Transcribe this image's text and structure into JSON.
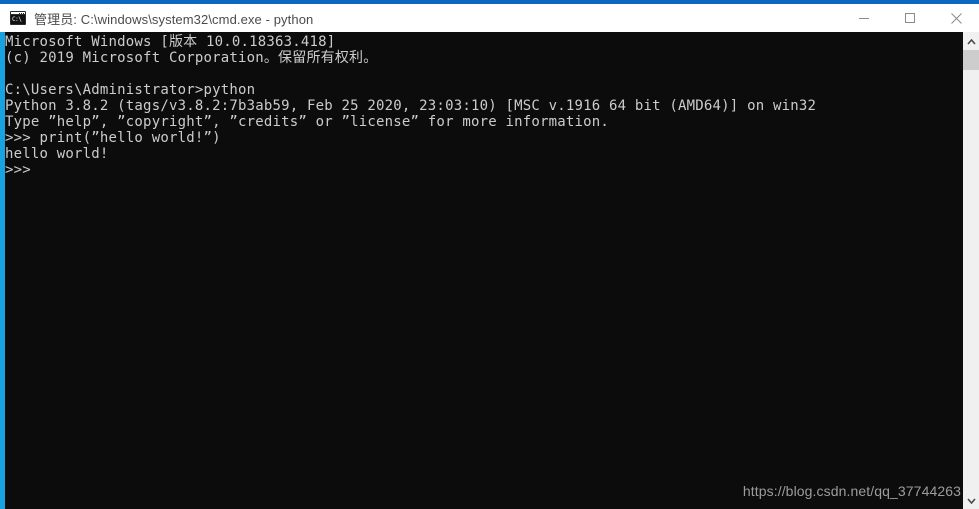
{
  "window": {
    "title": "管理员: C:\\windows\\system32\\cmd.exe - python",
    "icon_name": "cmd-console-icon",
    "icon_text": "C:\\",
    "accent_color": "#0c68c0",
    "left_accent_color": "#19a1e0",
    "titlebar_bg": "#ffffff",
    "title_color": "#4b4b4b"
  },
  "controls": {
    "minimize_label": "Minimize",
    "maximize_label": "Maximize",
    "close_label": "Close"
  },
  "console": {
    "background": "#0c0c0c",
    "foreground": "#cccccc",
    "lines": [
      "Microsoft Windows [版本 10.0.18363.418]",
      "(c) 2019 Microsoft Corporation。保留所有权利。",
      "",
      "C:\\Users\\Administrator>python",
      "Python 3.8.2 (tags/v3.8.2:7b3ab59, Feb 25 2020, 23:03:10) [MSC v.1916 64 bit (AMD64)] on win32",
      "Type ”help”, ”copyright”, ”credits” or ”license” for more information.",
      ">>> print(”hello world!”)",
      "hello world!",
      ">>>"
    ]
  },
  "watermark": {
    "text": "https://blog.csdn.net/qq_37744263",
    "color": "#9c9c9c"
  },
  "scrollbar": {
    "up_arrow": "▲",
    "down_arrow": "▼",
    "track_color": "#f0f0f0",
    "thumb_color": "#cdcdcd"
  }
}
